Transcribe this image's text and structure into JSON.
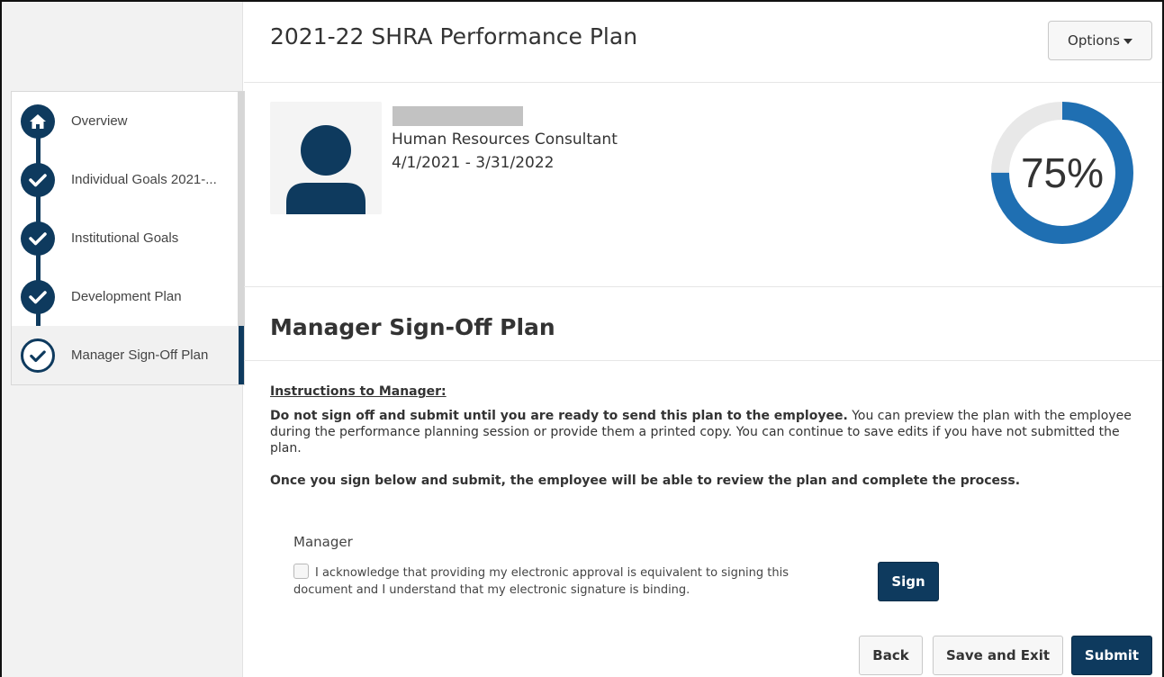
{
  "header": {
    "title": "2021-22 SHRA Performance Plan",
    "options_label": "Options"
  },
  "sidebar": {
    "items": [
      {
        "label": "Overview",
        "icon": "home-icon",
        "state": "home"
      },
      {
        "label": "Individual Goals 2021-...",
        "icon": "check-icon",
        "state": "complete"
      },
      {
        "label": "Institutional Goals",
        "icon": "check-icon",
        "state": "complete"
      },
      {
        "label": "Development Plan",
        "icon": "check-icon",
        "state": "complete"
      },
      {
        "label": "Manager Sign-Off Plan",
        "icon": "check-icon",
        "state": "active"
      }
    ]
  },
  "profile": {
    "job_title": "Human Resources Consultant",
    "dates": "4/1/2021 - 3/31/2022",
    "progress_percent": 75,
    "progress_label": "75%"
  },
  "section": {
    "title": "Manager Sign-Off Plan",
    "instructions_heading": "Instructions to Manager:",
    "para1_bold": "Do not sign off and submit until you are ready to send this plan to the employee.",
    "para1_rest": " You can preview the plan with the employee during the performance planning session or provide them a printed copy. You can continue to save edits if you have not submitted the plan.",
    "para2": "Once you sign below and submit, the employee will be able to review the plan and complete the process."
  },
  "signoff": {
    "role_label": "Manager",
    "acknowledgement": "I acknowledge that providing my electronic approval is equivalent to signing this document and I understand that my electronic signature is binding.",
    "checkbox_checked": false,
    "sign_label": "Sign"
  },
  "footer": {
    "back_label": "Back",
    "save_exit_label": "Save and Exit",
    "submit_label": "Submit"
  },
  "colors": {
    "primary": "#0e3a5e",
    "progress": "#1f6fb2",
    "progress_track": "#e8e8e8"
  }
}
